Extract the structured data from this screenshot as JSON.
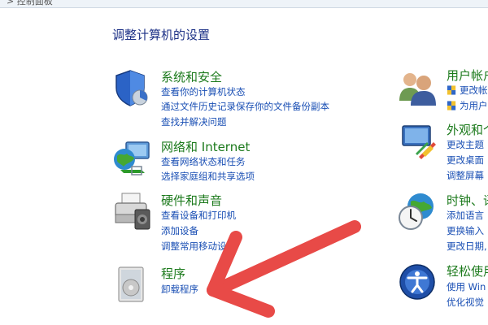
{
  "window": {
    "title_fragment": "> 控制面板"
  },
  "page_title": "调整计算机的设置",
  "categories": [
    {
      "title": "系统和安全",
      "links": [
        "查看你的计算机状态",
        "通过文件历史记录保存你的文件备份副本",
        "查找并解决问题"
      ],
      "icon": "shield-icon"
    },
    {
      "title": "网络和 Internet",
      "links": [
        "查看网络状态和任务",
        "选择家庭组和共享选项"
      ],
      "icon": "network-globe-icon"
    },
    {
      "title": "硬件和声音",
      "links": [
        "查看设备和打印机",
        "添加设备",
        "调整常用移动设置"
      ],
      "icon": "printer-icon"
    },
    {
      "title": "程序",
      "links": [
        "卸载程序"
      ],
      "icon": "programs-icon"
    },
    {
      "title": "用户帐户",
      "links": [
        "更改帐",
        "为用户"
      ],
      "icon": "users-icon"
    },
    {
      "title": "外观和个",
      "links": [
        "更改主题",
        "更改桌面",
        "调整屏幕"
      ],
      "icon": "appearance-icon"
    },
    {
      "title": "时钟、语",
      "links": [
        "添加语言",
        "更换输入",
        "更改日期,"
      ],
      "icon": "clock-globe-icon"
    },
    {
      "title": "轻松使用",
      "links": [
        "使用 Win",
        "优化视觉"
      ],
      "icon": "ease-of-access-icon"
    }
  ],
  "annotation": {
    "color": "#e84a47",
    "icon": "red-arrow-annotation"
  }
}
